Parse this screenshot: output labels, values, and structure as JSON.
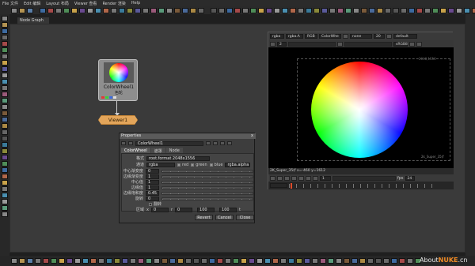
{
  "menu": [
    "File 文件",
    "Edit 编辑",
    "Layout 布局",
    "Viewer 查看",
    "Render 渲染",
    "Help"
  ],
  "node_graph": {
    "tab_label": "Node Graph",
    "colorwheel_node": {
      "name": "ColorWheel1",
      "label": "色轮"
    },
    "viewer_node": {
      "name": "Viewer1"
    }
  },
  "properties": {
    "title": "Properties",
    "close_glyph": "x",
    "node_name": "ColorWheel1",
    "tabs": [
      "ColorWheel",
      "遮罩",
      "Node"
    ],
    "rows": [
      {
        "label": "格式",
        "value": "root.format 2048x1556"
      },
      {
        "label": "通道",
        "value": "rgba"
      },
      {
        "label": "中心渐变度",
        "value": "0"
      },
      {
        "label": "边缘渐变度",
        "value": "1"
      },
      {
        "label": "中心值",
        "value": "1"
      },
      {
        "label": "边缘值",
        "value": "1"
      },
      {
        "label": "边缘饱和度",
        "value": "0.45"
      },
      {
        "label": "旋转",
        "value": "0"
      }
    ],
    "channels": [
      "red",
      "green",
      "blue",
      "rgba.alpha"
    ],
    "invert_label": "翻转",
    "area_label": "区域",
    "area_values": [
      "0",
      "0",
      "100",
      "100"
    ],
    "area_sep": [
      "x",
      "r",
      "t"
    ],
    "buttons": [
      "Revert",
      "Cancel",
      "Close"
    ]
  },
  "viewer": {
    "selects": [
      "rgba",
      "rgba.A",
      "RGB",
      "ColorWhe",
      "none",
      "default"
    ],
    "zoom": "20",
    "fps_label": "fps",
    "fps": "24",
    "frame": "1",
    "format_label_top": "2048,1556",
    "format_label_bottom": "2k_Super_35(f",
    "status": "2K_Super_35(f x=-460 y=1612",
    "gain": "2",
    "colorspace": "sRGB8"
  },
  "watermark": {
    "prefix": "About",
    "brand": "NUKE",
    "suffix": ".cn"
  }
}
